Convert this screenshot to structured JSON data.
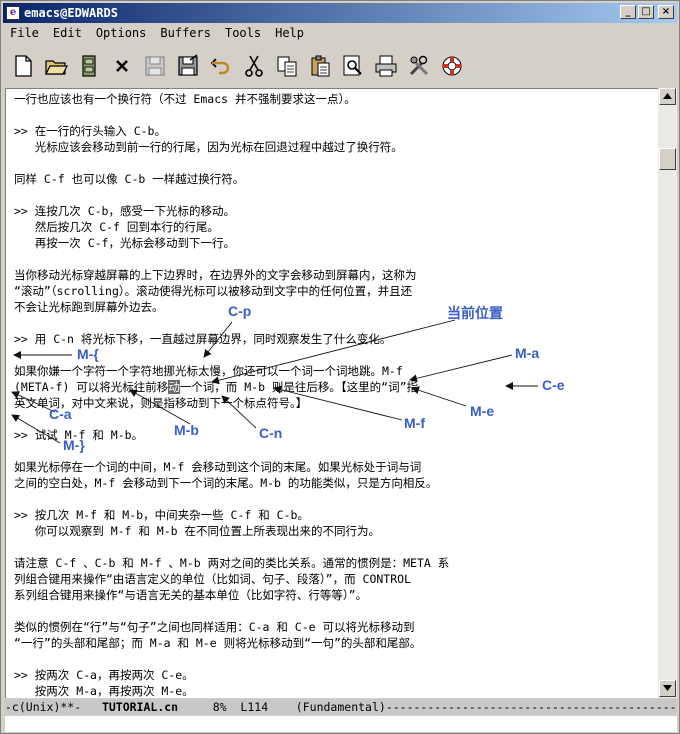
{
  "window": {
    "title": "emacs@EDWARDS",
    "controls": {
      "minimize": "_",
      "maximize": "□",
      "close": "×"
    }
  },
  "menu": [
    "File",
    "Edit",
    "Options",
    "Buffers",
    "Tools",
    "Help"
  ],
  "toolbar": [
    "new-file-icon",
    "open-folder-icon",
    "dired-cabinet-icon",
    "close-buffer-icon",
    "save-disk-icon",
    "save-as-icon",
    "undo-icon",
    "cut-icon",
    "copy-icon",
    "paste-icon",
    "search-icon",
    "print-icon",
    "preferences-icon",
    "help-lifebuoy-icon"
  ],
  "buffer_lines": [
    "一行也应该也有一个换行符（不过 Emacs 并不强制要求这一点）。",
    "",
    ">> 在一行的行头输入 C-b。",
    "   光标应该会移动到前一行的行尾，因为光标在回退过程中越过了换行符。",
    "",
    "同样 C-f 也可以像 C-b 一样越过换行符。",
    "",
    ">> 连按几次 C-b，感受一下光标的移动。",
    "   然后按几次 C-f 回到本行的行尾。",
    "   再按一次 C-f，光标会移动到下一行。",
    "",
    "当你移动光标穿越屏幕的上下边界时，在边界外的文字会移动到屏幕内，这称为",
    "“滚动”（scrolling）。滚动使得光标可以被移动到文字中的任何位置，并且还",
    "不会让光标跑到屏幕外边去。",
    "",
    ">> 用 C-n 将光标下移，一直越过屏幕边界，同时观察发生了什么变化。",
    "",
    "如果你嫌一个字符一个字符地挪光标太慢，你还可以一个词一个词地跳。M-f",
    "(META-f) 可以将光标往前移动一个词，而 M-b 则是往后移。【这里的“词”指",
    "英文单词，对中文来说，则是指移动到下一个标点符号。】",
    "",
    ">> 试试 M-f 和 M-b。",
    "",
    "如果光标停在一个词的中间，M-f 会移动到这个词的末尾。如果光标处于词与词",
    "之间的空白处，M-f 会移动到下一个词的末尾。M-b 的功能类似，只是方向相反。",
    "",
    ">> 按几次 M-f 和 M-b，中间夹杂一些 C-f 和 C-b。",
    "   你可以观察到 M-f 和 M-b 在不同位置上所表现出来的不同行为。",
    "",
    "请注意 C-f 、C-b 和 M-f 、M-b 两对之间的类比关系。通常的惯例是：META 系",
    "列组合键用来操作“由语言定义的单位（比如词、句子、段落）”，而 CONTROL",
    "系列组合键用来操作“与语言无关的基本单位（比如字符、行等等）”。",
    "",
    "类似的惯例在“行”与“句子”之间也同样适用：C-a 和 C-e 可以将光标移动到",
    "“一行”的头部和尾部；而 M-a 和 M-e 则将光标移动到“一句”的头部和尾部。",
    "",
    ">> 按两次 C-a，再按两次 C-e。",
    "   按两次 M-a，再按两次 M-e。"
  ],
  "cursor_line": {
    "before": "(META-f) 可以将光标往前移",
    "cursor_char": "动",
    "after": "一个词，而 M-b 则是往后移。【这里的“词”指"
  },
  "modeline": {
    "prefix": "-c(Unix)**-   ",
    "buffer_name": "TUTORIAL.cn",
    "rest": "     8%  L114    (Fundamental)------------------------------------------"
  },
  "annotations": {
    "current_position": "当前位置",
    "c_p": "C-p",
    "c_n": "C-n",
    "c_a": "C-a",
    "c_e": "C-e",
    "m_a": "M-a",
    "m_e": "M-e",
    "m_f": "M-f",
    "m_b": "M-b",
    "m_open": "M-{",
    "m_close": "M-}"
  },
  "colors": {
    "annotation": "#3a5dc9",
    "titlebar_start": "#0a246a",
    "titlebar_end": "#a6caf0"
  }
}
